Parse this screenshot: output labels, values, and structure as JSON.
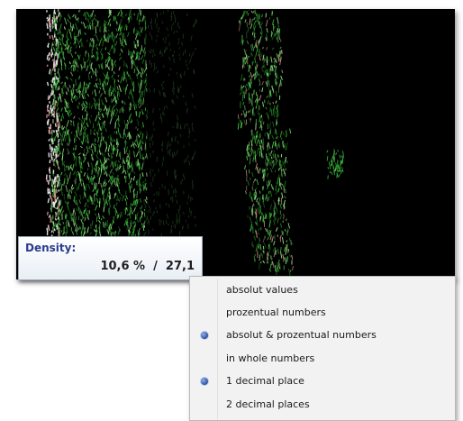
{
  "density": {
    "label": "Density:",
    "value": "10,6 %  /  27,1"
  },
  "menu": {
    "items": [
      {
        "label": "absolut values",
        "checked": false
      },
      {
        "label": "prozentual numbers",
        "checked": false
      },
      {
        "label": "absolut & prozentual numbers",
        "checked": true
      },
      {
        "label": "in whole numbers",
        "checked": false
      },
      {
        "label": "1 decimal place",
        "checked": true
      },
      {
        "label": "2 decimal places",
        "checked": false
      }
    ]
  },
  "viewer": {
    "background": "#000000",
    "tissue_colors": [
      "#1f7a1f",
      "#3fbf3f",
      "#8fe07f",
      "#ffffff",
      "#d98a8a",
      "#2e5a2e"
    ]
  }
}
